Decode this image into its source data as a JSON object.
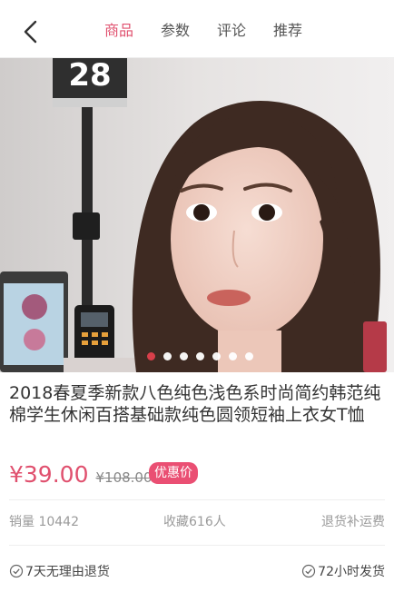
{
  "header": {
    "back_icon": "chevron-left-icon",
    "tabs": [
      {
        "label": "商品",
        "active": true
      },
      {
        "label": "参数",
        "active": false
      },
      {
        "label": "评论",
        "active": false
      },
      {
        "label": "推荐",
        "active": false
      }
    ]
  },
  "gallery": {
    "sign_text": "28",
    "slide_count": 7,
    "active_slide": 1
  },
  "product": {
    "title": "2018春夏季新款八色纯色浅色系时尚简约韩范纯棉学生休闲百搭基础款纯色圆领短袖上衣女T恤",
    "price": "¥39.00",
    "old_price": "¥108.00",
    "badge": "优惠价"
  },
  "stats": {
    "sales": "销量 10442",
    "favorites": "收藏616人",
    "shipping": "退货补运费"
  },
  "guarantees": {
    "return_policy": "7天无理由退货",
    "delivery": "72小时发货"
  },
  "colors": {
    "accent": "#e0506e",
    "badge": "#ea4f73"
  }
}
